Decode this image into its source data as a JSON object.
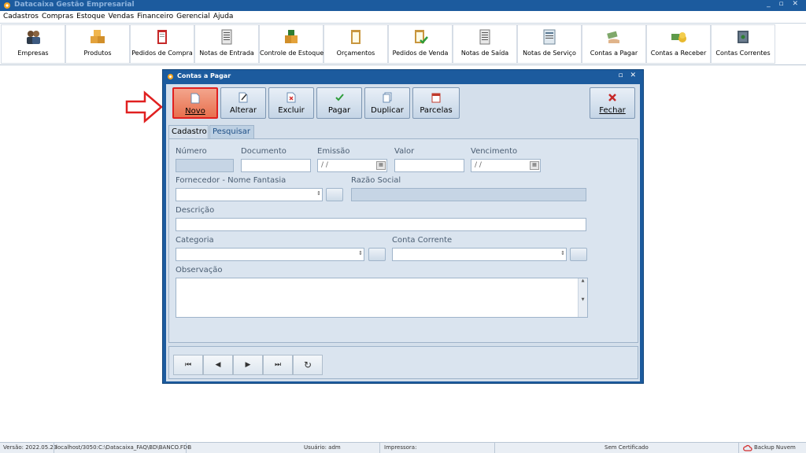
{
  "app": {
    "title": "Datacaixa Gestão Empresarial",
    "window_controls": "_ ▫ ✕"
  },
  "menu": [
    "Cadastros",
    "Compras",
    "Estoque",
    "Vendas",
    "Financeiro",
    "Gerencial",
    "Ajuda"
  ],
  "toolbar": [
    {
      "label": "Empresas",
      "icon": "people-icon"
    },
    {
      "label": "Produtos",
      "icon": "boxes-icon"
    },
    {
      "label": "Pedidos de Compra",
      "icon": "red-clipboard-icon"
    },
    {
      "label": "Notas de Entrada",
      "icon": "note-entry-icon"
    },
    {
      "label": "Controle de Estoque",
      "icon": "stock-boxes-icon"
    },
    {
      "label": "Orçamentos",
      "icon": "quote-clipboard-icon"
    },
    {
      "label": "Pedidos de Venda",
      "icon": "sales-order-icon"
    },
    {
      "label": "Notas de Saída",
      "icon": "note-exit-icon"
    },
    {
      "label": "Notas de Serviço",
      "icon": "service-note-icon"
    },
    {
      "label": "Contas a Pagar",
      "icon": "pay-hand-icon"
    },
    {
      "label": "Contas a Receber",
      "icon": "receive-money-icon"
    },
    {
      "label": "Contas Correntes",
      "icon": "safe-icon"
    }
  ],
  "window": {
    "title": "Contas a Pagar",
    "controls": "▫ ✕",
    "actions": {
      "novo": "Novo",
      "alterar": "Alterar",
      "excluir": "Excluir",
      "pagar": "Pagar",
      "duplicar": "Duplicar",
      "parcelas": "Parcelas",
      "fechar": "Fechar"
    },
    "tabs": {
      "cadastro": "Cadastro",
      "pesquisar": "Pesquisar"
    },
    "fields": {
      "numero": {
        "label": "Número",
        "value": ""
      },
      "documento": {
        "label": "Documento",
        "value": ""
      },
      "emissao": {
        "label": "Emissão",
        "value": " /  /"
      },
      "valor": {
        "label": "Valor",
        "value": ""
      },
      "vencimento": {
        "label": "Vencimento",
        "value": " /  /"
      },
      "fornecedor": {
        "label": "Fornecedor - Nome Fantasia",
        "value": ""
      },
      "razao_social": {
        "label": "Razão Social",
        "value": ""
      },
      "descricao": {
        "label": "Descrição",
        "value": ""
      },
      "categoria": {
        "label": "Categoria",
        "value": ""
      },
      "conta_corrente": {
        "label": "Conta Corrente",
        "value": ""
      },
      "observacao": {
        "label": "Observação",
        "value": ""
      }
    },
    "nav": {
      "first": "⏮",
      "prev": "◀",
      "next": "▶",
      "last": "⏭",
      "refresh": "↻"
    }
  },
  "status": {
    "versao": "Versão: 2022.05.23",
    "db": "localhost/3050:C:\\Datacaixa_FAQ\\BD\\BANCO.FDB",
    "usuario": "Usuário: adm",
    "impressora": "Impressora:",
    "certificado": "Sem Certificado",
    "backup": "Backup Nuvem"
  },
  "colors": {
    "title_bar": "#1c5b9e",
    "highlight": "#e02020",
    "window_bg": "#d4dfeb"
  }
}
